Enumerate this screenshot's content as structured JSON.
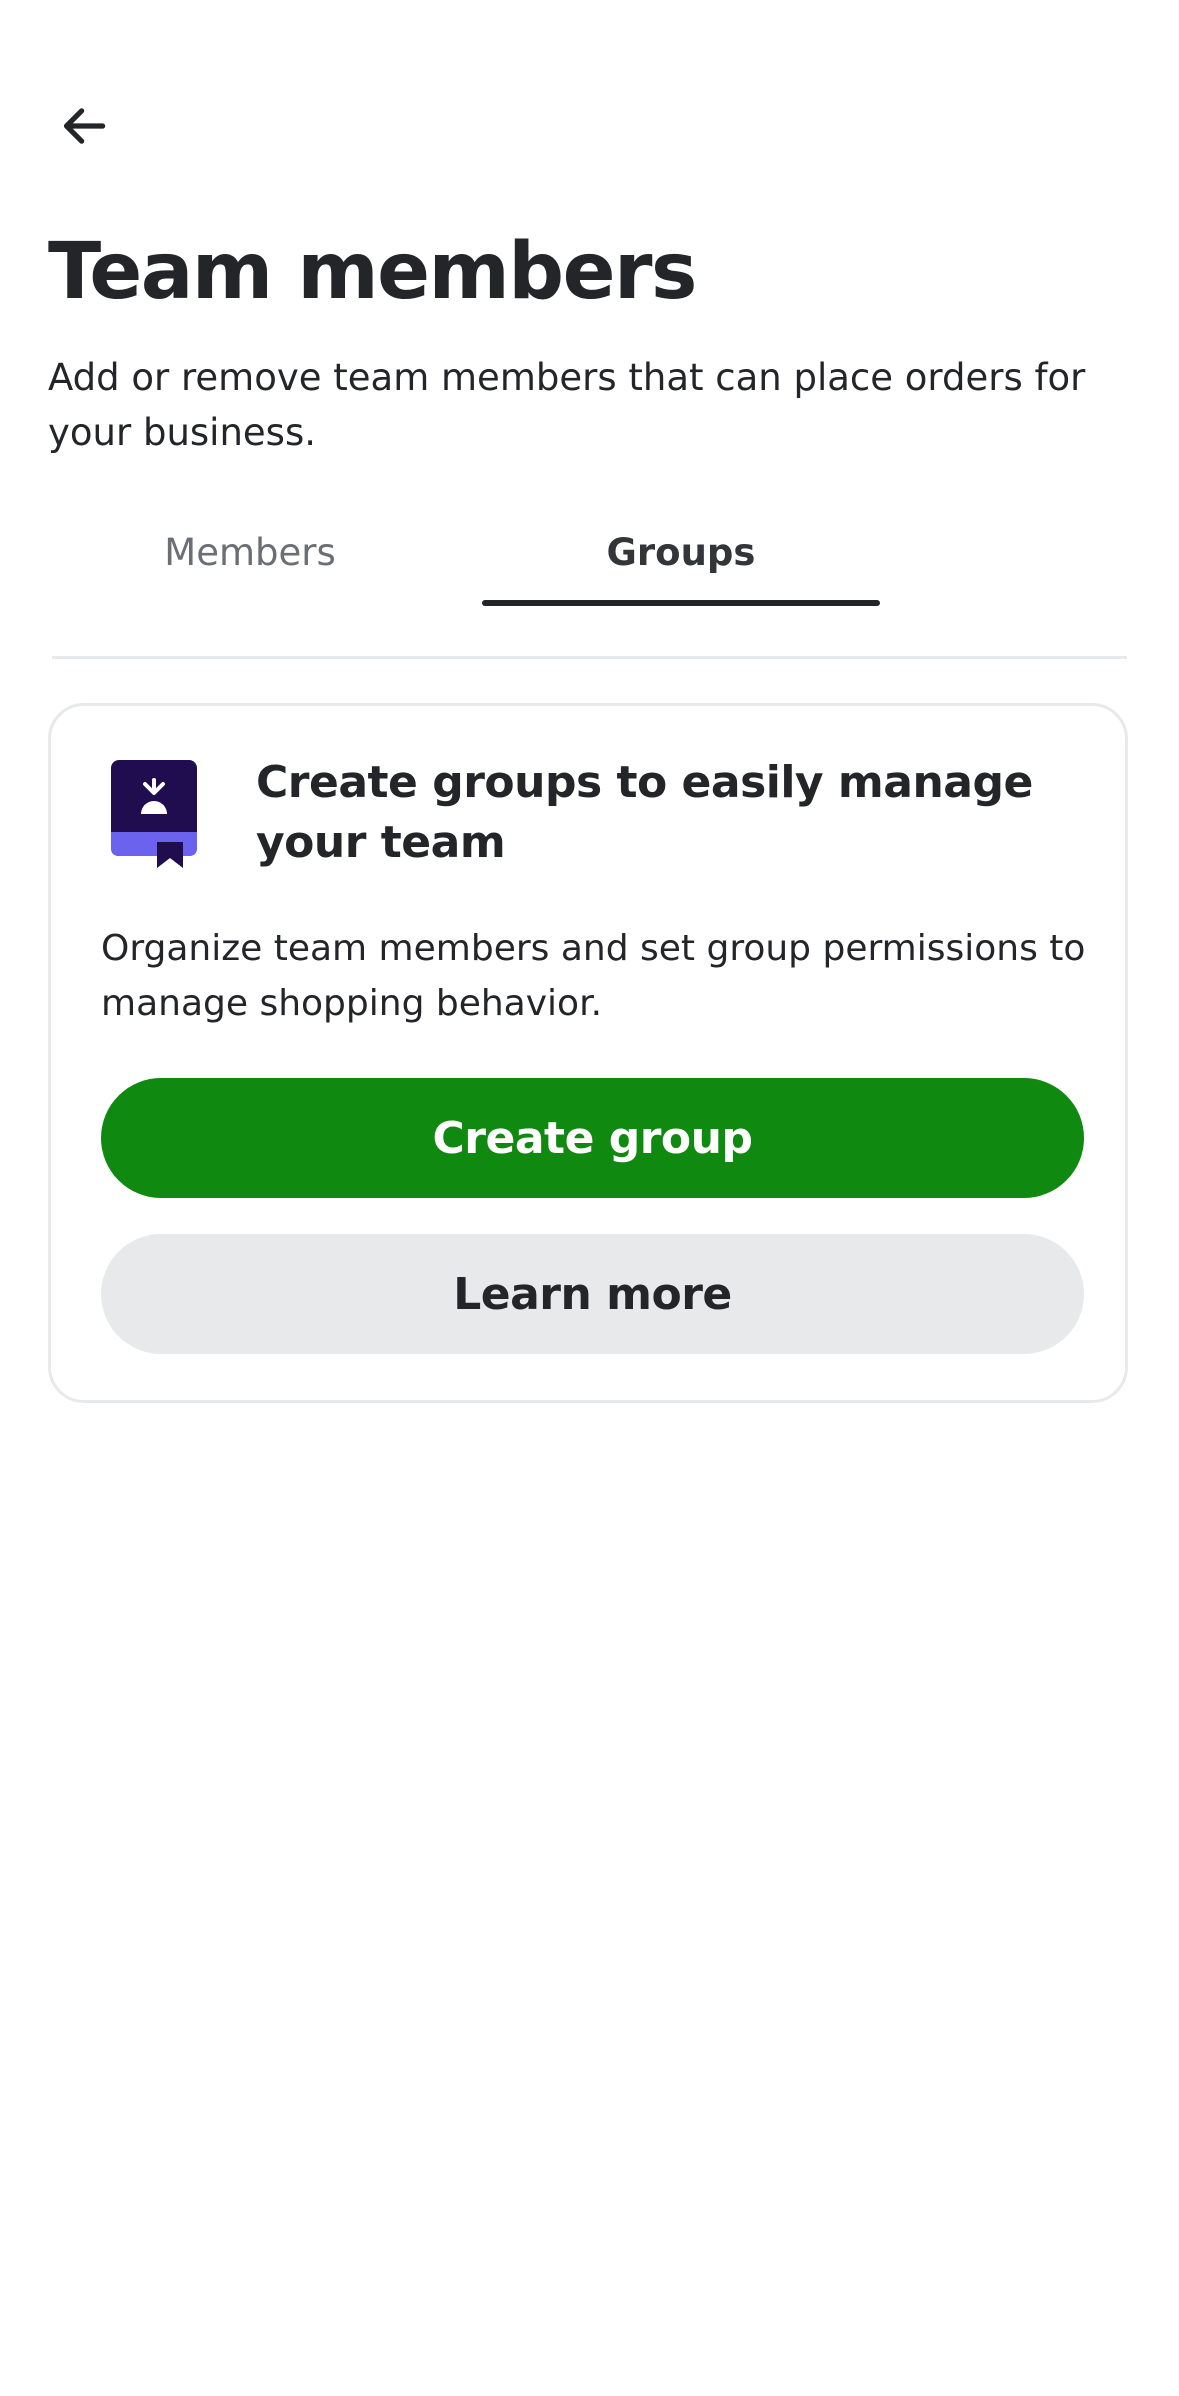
{
  "header": {
    "back_icon": "arrow-left-icon",
    "title": "Team members",
    "subtitle": "Add or remove team members that can place orders for your business."
  },
  "tabs": [
    {
      "label": "Members",
      "selected": false
    },
    {
      "label": "Groups",
      "selected": true
    }
  ],
  "card": {
    "icon": "book-bookmark-icon",
    "title": "Create groups to easily manage your team",
    "description": "Organize team members and set group permissions to manage shopping behavior.",
    "primary_button": "Create group",
    "secondary_button": "Learn more"
  },
  "colors": {
    "accent_green": "#108910",
    "text_primary": "#242529",
    "text_secondary": "#6b6e75",
    "secondary_button_bg": "#e8e9eb",
    "icon_dark": "#1f0d4f",
    "icon_light": "#6b63ee"
  }
}
